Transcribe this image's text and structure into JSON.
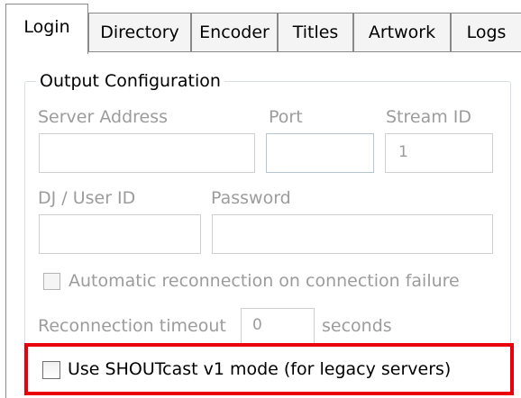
{
  "tabs": [
    {
      "label": "Login",
      "active": true
    },
    {
      "label": "Directory",
      "active": false
    },
    {
      "label": "Encoder",
      "active": false
    },
    {
      "label": "Titles",
      "active": false
    },
    {
      "label": "Artwork",
      "active": false
    },
    {
      "label": "Logs",
      "active": false
    }
  ],
  "output_config": {
    "title": "Output Configuration",
    "server_address": {
      "label": "Server Address",
      "value": "",
      "enabled": false
    },
    "port": {
      "label": "Port",
      "value": "",
      "enabled": false
    },
    "stream_id": {
      "label": "Stream ID",
      "value": "1",
      "enabled": false
    },
    "dj_user_id": {
      "label": "DJ / User ID",
      "value": "",
      "enabled": false
    },
    "password": {
      "label": "Password",
      "value": "",
      "enabled": false
    },
    "auto_reconnect": {
      "label": "Automatic reconnection on connection failure",
      "checked": false,
      "enabled": false
    },
    "reconnect_timeout": {
      "label": "Reconnection timeout",
      "value": "0",
      "unit": "seconds",
      "enabled": false
    },
    "shoutcast_v1": {
      "label": "Use SHOUTcast v1 mode (for legacy servers)",
      "checked": false,
      "enabled": true
    }
  },
  "colors": {
    "highlight_border": "#e8000b",
    "disabled_text": "#9c9c9c"
  }
}
